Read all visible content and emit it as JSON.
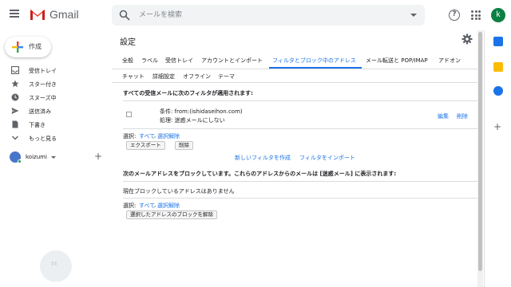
{
  "topbar": {
    "brand": "Gmail",
    "search_placeholder": "メールを検索",
    "help_label": "?",
    "avatar_letter": "k"
  },
  "sidebar": {
    "compose_label": "作成",
    "items": [
      {
        "label": "受信トレイ",
        "icon": "inbox-icon"
      },
      {
        "label": "スター付き",
        "icon": "star-icon"
      },
      {
        "label": "スヌーズ中",
        "icon": "clock-icon"
      },
      {
        "label": "送信済み",
        "icon": "send-icon"
      },
      {
        "label": "下書き",
        "icon": "draft-icon"
      },
      {
        "label": "もっと見る",
        "icon": "chevron-down-icon"
      }
    ],
    "user_name": "koizumi",
    "add_label": "+"
  },
  "settings": {
    "title": "設定",
    "tabs_row1": [
      "全般",
      "ラベル",
      "受信トレイ",
      "アカウントとインポート",
      "フィルタとブロック中のアドレス",
      "メール転送と POP/IMAP",
      "アドオン"
    ],
    "tabs_row2": [
      "チャット",
      "詳細設定",
      "オフライン",
      "テーマ"
    ],
    "active_tab": "フィルタとブロック中のアドレス",
    "filters_heading": "すべての受信メールに次のフィルタが適用されます:",
    "filter": {
      "condition": "条件: from:(ishidaseihon.com)",
      "action": "処理: 迷惑メールにしない",
      "edit_label": "編集",
      "delete_label": "削除"
    },
    "select_prefix": "選択: ",
    "select_all": "すべて",
    "select_none": "選択解除",
    "export_button": "エクスポート",
    "delete_button": "削除",
    "create_filter_link": "新しいフィルタを作成",
    "import_filter_link": "フィルタをインポート",
    "blocked_heading": "次のメールアドレスをブロックしています。これらのアドレスからのメールは [迷惑メール] に表示されます:",
    "blocked_empty": "現在ブロックしているアドレスはありません",
    "unblock_button": "選択したアドレスのブロックを解除"
  },
  "colors": {
    "accent": "#1a73e8",
    "gmail_red": "#ea4335",
    "avatar_green": "#0b8043"
  }
}
